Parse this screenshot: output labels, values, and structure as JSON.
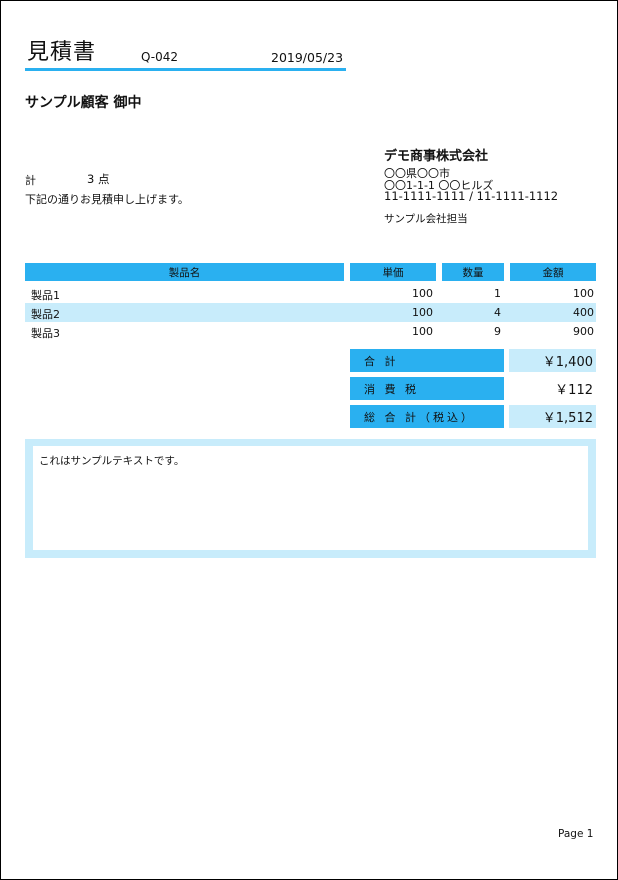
{
  "header": {
    "title": "見積書",
    "doc_number": "Q-042",
    "date": "2019/05/23"
  },
  "customer": {
    "name": "サンプル顧客 御中"
  },
  "summary": {
    "count_label": "計",
    "count_value": "3 点",
    "intro": "下記の通りお見積申し上げます。"
  },
  "issuer": {
    "company": "デモ商事株式会社",
    "address_line1": "〇〇県〇〇市",
    "address_line2": "〇〇1-1-1 〇〇ヒルズ",
    "phone": "11-1111-1111 / 11-1111-1112",
    "contact": "サンプル会社担当"
  },
  "table": {
    "headers": [
      "製品名",
      "単価",
      "数量",
      "金額"
    ],
    "rows": [
      {
        "name": "製品1",
        "price": "100",
        "qty": "1",
        "amount": "100"
      },
      {
        "name": "製品2",
        "price": "100",
        "qty": "4",
        "amount": "400"
      },
      {
        "name": "製品3",
        "price": "100",
        "qty": "9",
        "amount": "900"
      }
    ]
  },
  "totals": {
    "subtotal_label": "合 計",
    "subtotal_value": "￥1,400",
    "tax_label": "消 費 税",
    "tax_value": "￥112",
    "grand_label": "総 合 計（税込）",
    "grand_value": "￥1,512"
  },
  "note": {
    "text": "これはサンプルテキストです。"
  },
  "footer": {
    "page": "Page 1"
  },
  "colors": {
    "accent": "#2ab0f0",
    "light": "#c8ecfb"
  }
}
